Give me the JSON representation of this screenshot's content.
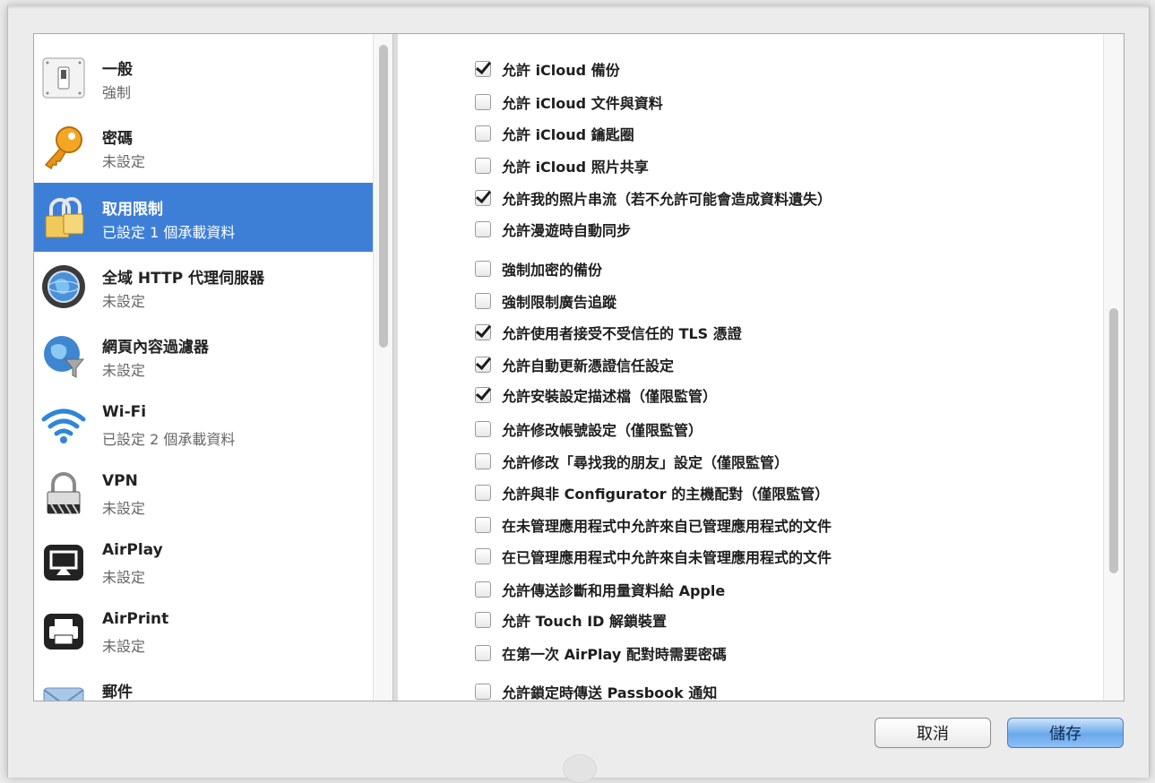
{
  "sidebar": {
    "items": [
      {
        "title": "一般",
        "subtitle": "強制",
        "icon": "switch-icon"
      },
      {
        "title": "密碼",
        "subtitle": "未設定",
        "icon": "key-icon"
      },
      {
        "title": "取用限制",
        "subtitle": "已設定 1 個承載資料",
        "icon": "lock-icon",
        "selected": true
      },
      {
        "title": "全域 HTTP 代理伺服器",
        "subtitle": "未設定",
        "icon": "globe-proxy-icon"
      },
      {
        "title": "網頁內容過濾器",
        "subtitle": "未設定",
        "icon": "globe-filter-icon"
      },
      {
        "title": "Wi-Fi",
        "subtitle": "已設定 2 個承載資料",
        "icon": "wifi-icon"
      },
      {
        "title": "VPN",
        "subtitle": "未設定",
        "icon": "vpn-lock-icon"
      },
      {
        "title": "AirPlay",
        "subtitle": "未設定",
        "icon": "airplay-icon"
      },
      {
        "title": "AirPrint",
        "subtitle": "未設定",
        "icon": "printer-icon"
      },
      {
        "title": "郵件",
        "subtitle": "",
        "icon": "mail-icon"
      }
    ]
  },
  "restrictions": [
    {
      "label": "允許 iCloud 備份",
      "checked": true
    },
    {
      "label": "允許 iCloud 文件與資料",
      "checked": false
    },
    {
      "label": "允許 iCloud 鑰匙圈",
      "checked": false
    },
    {
      "label": "允許 iCloud 照片共享",
      "checked": false
    },
    {
      "label": "允許我的照片串流（若不允許可能會造成資料遺失）",
      "checked": true
    },
    {
      "label": "允許漫遊時自動同步",
      "checked": false
    },
    {
      "label": "強制加密的備份",
      "checked": false
    },
    {
      "label": "強制限制廣告追蹤",
      "checked": false
    },
    {
      "label": "允許使用者接受不受信任的 TLS 憑證",
      "checked": true
    },
    {
      "label": "允許自動更新憑證信任設定",
      "checked": true
    },
    {
      "label": "允許安裝設定描述檔（僅限監管）",
      "checked": true
    },
    {
      "label": "允許修改帳號設定（僅限監管）",
      "checked": false
    },
    {
      "label": "允許修改「尋找我的朋友」設定（僅限監管）",
      "checked": false
    },
    {
      "label": "允許與非 Configurator 的主機配對（僅限監管）",
      "checked": false
    },
    {
      "label": "在未管理應用程式中允許來自已管理應用程式的文件",
      "checked": false
    },
    {
      "label": "在已管理應用程式中允許來自未管理應用程式的文件",
      "checked": false
    },
    {
      "label": "允許傳送診斷和用量資料給 Apple",
      "checked": false
    },
    {
      "label": "允許 Touch ID 解鎖裝置",
      "checked": false
    },
    {
      "label": "在第一次 AirPlay 配對時需要密碼",
      "checked": false
    },
    {
      "label": "允許鎖定時傳送 Passbook 通知",
      "checked": false
    }
  ],
  "buttons": {
    "cancel": "取消",
    "save": "儲存"
  }
}
